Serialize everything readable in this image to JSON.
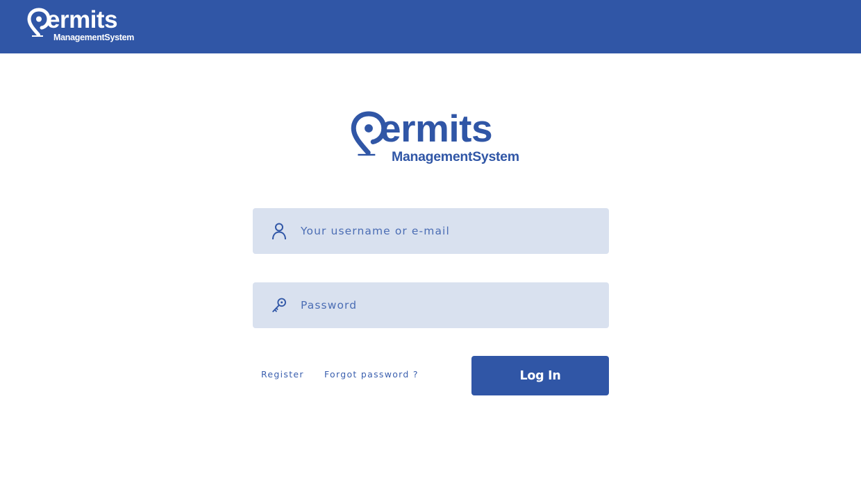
{
  "brand": {
    "name": "ermits",
    "tagline": "ManagementSystem",
    "color": "#3056a6"
  },
  "header": {
    "logo_icon": "location-pin-icon"
  },
  "login": {
    "username_placeholder": "Your username or e-mail",
    "username_icon": "user-icon",
    "password_placeholder": "Password",
    "password_icon": "key-icon",
    "register_label": "Register",
    "forgot_label": "Forgot password ?",
    "login_label": "Log In"
  }
}
